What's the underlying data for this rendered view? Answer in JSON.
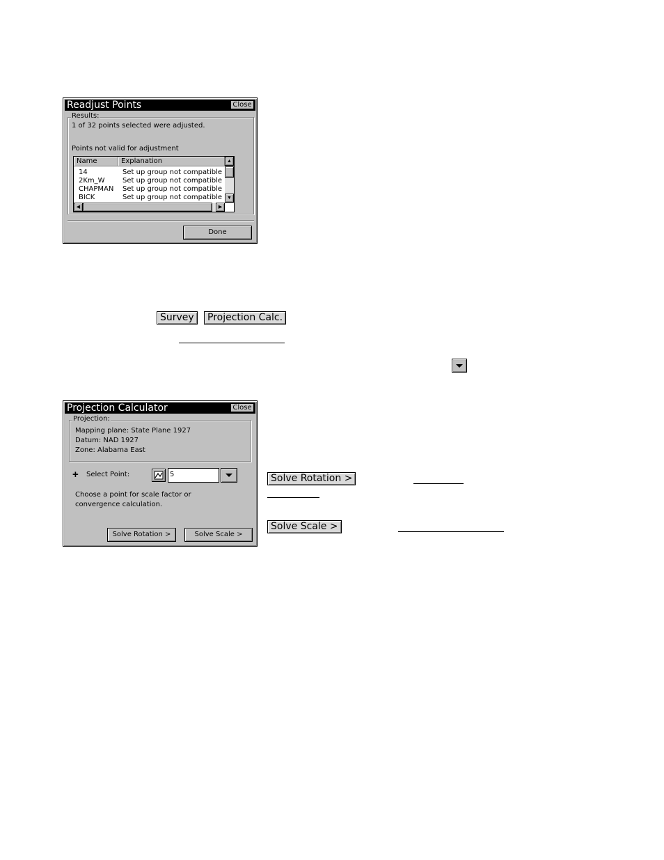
{
  "readjust": {
    "title": "Readjust Points",
    "close_label": "Close",
    "results_label": "Results:",
    "summary": "1 of 32 points selected were adjusted.",
    "invalid_label": "Points not valid for adjustment",
    "columns": [
      "Name",
      "Explanation"
    ],
    "rows": [
      {
        "name": "14",
        "explanation": "Set up group not compatible"
      },
      {
        "name": "2Km_W",
        "explanation": "Set up group not compatible"
      },
      {
        "name": "CHAPMAN",
        "explanation": "Set up group not compatible"
      },
      {
        "name": "BICK",
        "explanation": "Set up group not compatible"
      }
    ],
    "done_label": "Done"
  },
  "menu_buttons": {
    "survey": "Survey",
    "projection_calc": "Projection Calc."
  },
  "projection": {
    "title": "Projection Calculator",
    "close_label": "Close",
    "group_label": "Projection:",
    "mapping_plane": "Mapping plane: State Plane 1927",
    "datum": "Datum: NAD 1927",
    "zone": "Zone: Alabama East",
    "select_point_label": "Select Point:",
    "select_point_value": "5",
    "hint_line1": "Choose a point for scale factor or",
    "hint_line2": "convergence calculation.",
    "solve_rotation_label": "Solve Rotation >",
    "solve_scale_label": "Solve Scale >"
  },
  "doc_buttons": {
    "solve_rotation": "Solve Rotation >",
    "solve_scale": "Solve Scale >"
  },
  "icons": {
    "dropdown": "triangle-down-icon",
    "map_select": "map-select-icon",
    "plus": "plus-icon"
  }
}
